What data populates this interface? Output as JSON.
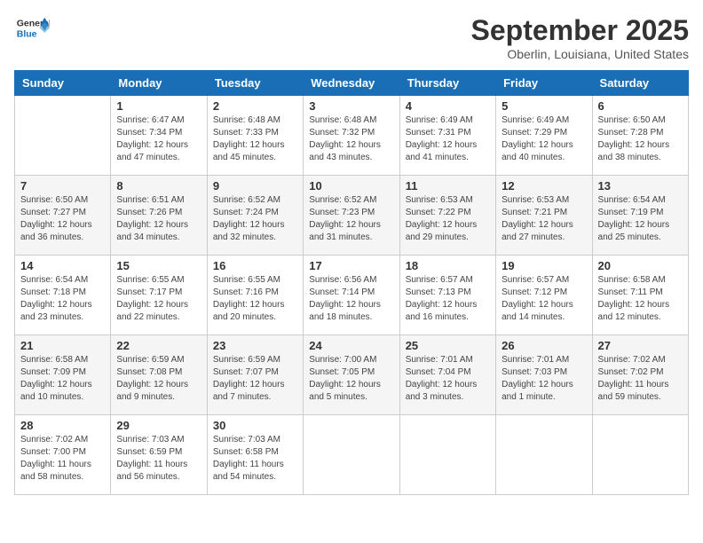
{
  "header": {
    "logo_general": "General",
    "logo_blue": "Blue",
    "month": "September 2025",
    "location": "Oberlin, Louisiana, United States"
  },
  "weekdays": [
    "Sunday",
    "Monday",
    "Tuesday",
    "Wednesday",
    "Thursday",
    "Friday",
    "Saturday"
  ],
  "weeks": [
    [
      {
        "day": "",
        "info": ""
      },
      {
        "day": "1",
        "info": "Sunrise: 6:47 AM\nSunset: 7:34 PM\nDaylight: 12 hours\nand 47 minutes."
      },
      {
        "day": "2",
        "info": "Sunrise: 6:48 AM\nSunset: 7:33 PM\nDaylight: 12 hours\nand 45 minutes."
      },
      {
        "day": "3",
        "info": "Sunrise: 6:48 AM\nSunset: 7:32 PM\nDaylight: 12 hours\nand 43 minutes."
      },
      {
        "day": "4",
        "info": "Sunrise: 6:49 AM\nSunset: 7:31 PM\nDaylight: 12 hours\nand 41 minutes."
      },
      {
        "day": "5",
        "info": "Sunrise: 6:49 AM\nSunset: 7:29 PM\nDaylight: 12 hours\nand 40 minutes."
      },
      {
        "day": "6",
        "info": "Sunrise: 6:50 AM\nSunset: 7:28 PM\nDaylight: 12 hours\nand 38 minutes."
      }
    ],
    [
      {
        "day": "7",
        "info": "Sunrise: 6:50 AM\nSunset: 7:27 PM\nDaylight: 12 hours\nand 36 minutes."
      },
      {
        "day": "8",
        "info": "Sunrise: 6:51 AM\nSunset: 7:26 PM\nDaylight: 12 hours\nand 34 minutes."
      },
      {
        "day": "9",
        "info": "Sunrise: 6:52 AM\nSunset: 7:24 PM\nDaylight: 12 hours\nand 32 minutes."
      },
      {
        "day": "10",
        "info": "Sunrise: 6:52 AM\nSunset: 7:23 PM\nDaylight: 12 hours\nand 31 minutes."
      },
      {
        "day": "11",
        "info": "Sunrise: 6:53 AM\nSunset: 7:22 PM\nDaylight: 12 hours\nand 29 minutes."
      },
      {
        "day": "12",
        "info": "Sunrise: 6:53 AM\nSunset: 7:21 PM\nDaylight: 12 hours\nand 27 minutes."
      },
      {
        "day": "13",
        "info": "Sunrise: 6:54 AM\nSunset: 7:19 PM\nDaylight: 12 hours\nand 25 minutes."
      }
    ],
    [
      {
        "day": "14",
        "info": "Sunrise: 6:54 AM\nSunset: 7:18 PM\nDaylight: 12 hours\nand 23 minutes."
      },
      {
        "day": "15",
        "info": "Sunrise: 6:55 AM\nSunset: 7:17 PM\nDaylight: 12 hours\nand 22 minutes."
      },
      {
        "day": "16",
        "info": "Sunrise: 6:55 AM\nSunset: 7:16 PM\nDaylight: 12 hours\nand 20 minutes."
      },
      {
        "day": "17",
        "info": "Sunrise: 6:56 AM\nSunset: 7:14 PM\nDaylight: 12 hours\nand 18 minutes."
      },
      {
        "day": "18",
        "info": "Sunrise: 6:57 AM\nSunset: 7:13 PM\nDaylight: 12 hours\nand 16 minutes."
      },
      {
        "day": "19",
        "info": "Sunrise: 6:57 AM\nSunset: 7:12 PM\nDaylight: 12 hours\nand 14 minutes."
      },
      {
        "day": "20",
        "info": "Sunrise: 6:58 AM\nSunset: 7:11 PM\nDaylight: 12 hours\nand 12 minutes."
      }
    ],
    [
      {
        "day": "21",
        "info": "Sunrise: 6:58 AM\nSunset: 7:09 PM\nDaylight: 12 hours\nand 10 minutes."
      },
      {
        "day": "22",
        "info": "Sunrise: 6:59 AM\nSunset: 7:08 PM\nDaylight: 12 hours\nand 9 minutes."
      },
      {
        "day": "23",
        "info": "Sunrise: 6:59 AM\nSunset: 7:07 PM\nDaylight: 12 hours\nand 7 minutes."
      },
      {
        "day": "24",
        "info": "Sunrise: 7:00 AM\nSunset: 7:05 PM\nDaylight: 12 hours\nand 5 minutes."
      },
      {
        "day": "25",
        "info": "Sunrise: 7:01 AM\nSunset: 7:04 PM\nDaylight: 12 hours\nand 3 minutes."
      },
      {
        "day": "26",
        "info": "Sunrise: 7:01 AM\nSunset: 7:03 PM\nDaylight: 12 hours\nand 1 minute."
      },
      {
        "day": "27",
        "info": "Sunrise: 7:02 AM\nSunset: 7:02 PM\nDaylight: 11 hours\nand 59 minutes."
      }
    ],
    [
      {
        "day": "28",
        "info": "Sunrise: 7:02 AM\nSunset: 7:00 PM\nDaylight: 11 hours\nand 58 minutes."
      },
      {
        "day": "29",
        "info": "Sunrise: 7:03 AM\nSunset: 6:59 PM\nDaylight: 11 hours\nand 56 minutes."
      },
      {
        "day": "30",
        "info": "Sunrise: 7:03 AM\nSunset: 6:58 PM\nDaylight: 11 hours\nand 54 minutes."
      },
      {
        "day": "",
        "info": ""
      },
      {
        "day": "",
        "info": ""
      },
      {
        "day": "",
        "info": ""
      },
      {
        "day": "",
        "info": ""
      }
    ]
  ]
}
